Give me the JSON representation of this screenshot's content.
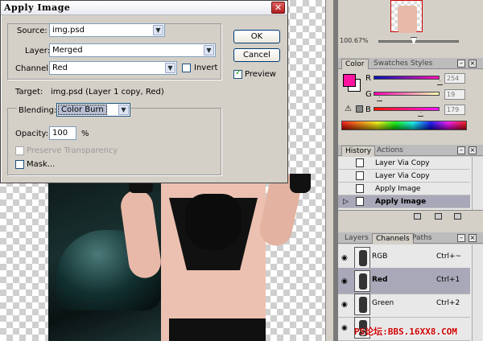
{
  "dialog": {
    "title": "Apply Image",
    "close_symbol": "✕",
    "source": {
      "legend": "Source:",
      "value": "img.psd"
    },
    "layer": {
      "label": "Layer:",
      "value": "Merged"
    },
    "channel": {
      "label": "Channel:",
      "value": "Red",
      "invert_label": "Invert",
      "invert_checked": false
    },
    "target": {
      "label": "Target:",
      "value": "img.psd (Layer 1 copy, Red)"
    },
    "blending": {
      "label": "Blending:",
      "value": "Color Burn"
    },
    "opacity": {
      "label": "Opacity:",
      "value": "100",
      "unit": "%"
    },
    "preserve_transparency_label": "Preserve Transparency",
    "mask_label": "Mask...",
    "ok_label": "OK",
    "cancel_label": "Cancel",
    "preview_label": "Preview",
    "preview_checked": true
  },
  "navigator": {
    "zoom": "100.67%"
  },
  "color_panel": {
    "tabs": [
      "Color",
      "Swatches",
      "Styles"
    ],
    "foreground": "#fe13a0",
    "background": "#ffffff",
    "r": {
      "label": "R",
      "value": "254"
    },
    "g": {
      "label": "G",
      "value": "19"
    },
    "b": {
      "label": "B",
      "value": "179"
    }
  },
  "history_panel": {
    "tabs": [
      "History",
      "Actions"
    ],
    "items": [
      {
        "label": "Layer Via Copy"
      },
      {
        "label": "Layer Via Copy"
      },
      {
        "label": "Apply Image"
      },
      {
        "label": "Apply Image"
      }
    ]
  },
  "channels_panel": {
    "tabs": [
      "Layers",
      "Channels",
      "Paths"
    ],
    "rows": [
      {
        "name": "RGB",
        "shortcut": "Ctrl+~"
      },
      {
        "name": "Red",
        "shortcut": "Ctrl+1"
      },
      {
        "name": "Green",
        "shortcut": "Ctrl+2"
      },
      {
        "name": "",
        "shortcut": ""
      }
    ]
  },
  "watermark": "PS论坛:BBS.16XX8.COM"
}
